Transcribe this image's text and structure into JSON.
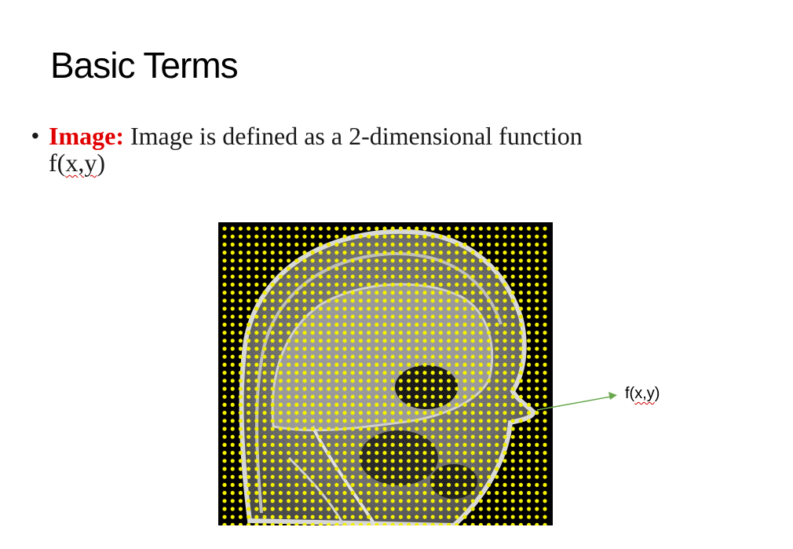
{
  "slide": {
    "title": "Basic Terms",
    "bullet": {
      "term": "Image:",
      "definition": " Image is defined as a 2-dimensional function",
      "function_name": "f(",
      "function_args": "x,y",
      "function_close": ")"
    },
    "figure": {
      "description_icon": "mri-head-sampling-grid-image",
      "grid_dot_color": "#f4f000"
    },
    "callout": {
      "name": "f(",
      "args": "x,y",
      "close": ")",
      "arrow_color": "#6aa84f"
    }
  }
}
